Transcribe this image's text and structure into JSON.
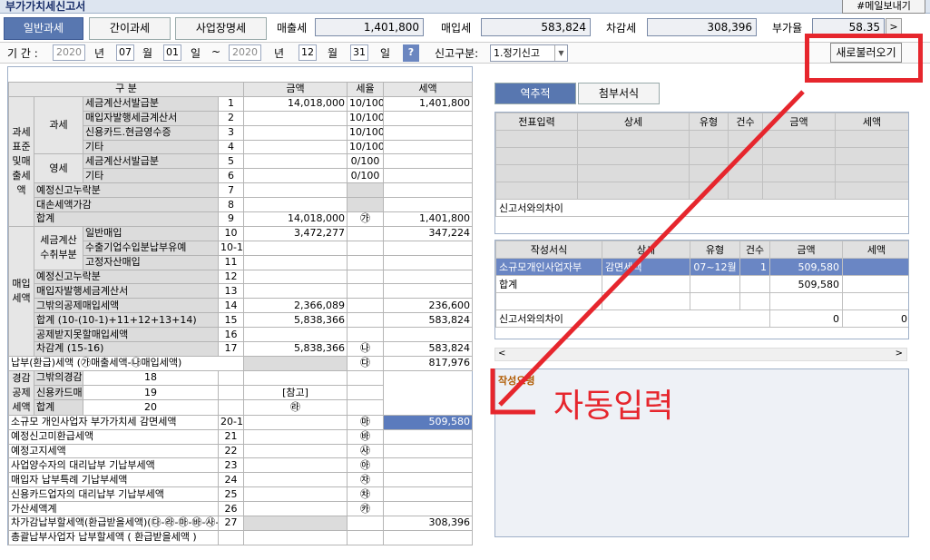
{
  "title": "부가가치세신고서",
  "mail_button": "#메일보내기",
  "tabs": [
    "일반과세",
    "간이과세",
    "사업장명세"
  ],
  "summary": {
    "sales_label": "매출세",
    "sales": "1,401,800",
    "purchase_label": "매입세",
    "purchase": "583,824",
    "diff_label": "차감세",
    "diff": "308,396",
    "rate_label": "부가율",
    "rate": "58.35",
    "next": ">"
  },
  "filter": {
    "period_label": "기 간 :",
    "y1": "2020",
    "year": "년",
    "m1": "07",
    "month": "월",
    "d1": "01",
    "day": "일",
    "tilde": "~",
    "y2": "2020",
    "m2": "12",
    "d2": "31",
    "help": "?",
    "type_label": "신고구분:",
    "type_value": "1.정기신고"
  },
  "reload_button": "새로불러오기",
  "main_headers": [
    "구 분",
    "금액",
    "세율",
    "세액"
  ],
  "side_labels": {
    "a": "과세표준및매출세액",
    "b": "과세",
    "c": "영세",
    "d": "매입세액",
    "e": "세금계산수취부분",
    "f": "경감공제세액"
  },
  "rows": [
    [
      "세금계산서발급분",
      "1",
      "14,018,000",
      "10/100",
      "1,401,800"
    ],
    [
      "매입자발행세금계산서",
      "2",
      "",
      "10/100",
      ""
    ],
    [
      "신용카드.현금영수증",
      "3",
      "",
      "10/100",
      ""
    ],
    [
      "기타",
      "4",
      "",
      "10/100",
      ""
    ],
    [
      "세금계산서발급분",
      "5",
      "",
      "0/100",
      ""
    ],
    [
      "기타",
      "6",
      "",
      "0/100",
      ""
    ],
    [
      "예정신고누락분",
      "7",
      "",
      "",
      ""
    ],
    [
      "대손세액가감",
      "8",
      "",
      "",
      ""
    ],
    [
      "합계",
      "9",
      "14,018,000",
      "㉮",
      "1,401,800"
    ],
    [
      "일반매입",
      "10",
      "3,472,277",
      "",
      "347,224"
    ],
    [
      "수출기업수입분납부유예",
      "10-1",
      "",
      "",
      ""
    ],
    [
      "고정자산매입",
      "11",
      "",
      "",
      ""
    ],
    [
      "예정신고누락분",
      "12",
      "",
      "",
      ""
    ],
    [
      "매입자발행세금계산서",
      "13",
      "",
      "",
      ""
    ],
    [
      "그밖의공제매입세액",
      "14",
      "2,366,089",
      "",
      "236,600"
    ],
    [
      "합계 (10-(10-1)+11+12+13+14)",
      "15",
      "5,838,366",
      "",
      "583,824"
    ],
    [
      "공제받지못할매입세액",
      "16",
      "",
      "",
      ""
    ],
    [
      "차감계 (15-16)",
      "17",
      "5,838,366",
      "㉯",
      "583,824"
    ],
    [
      "납부(환급)세액 (㉮매출세액-㉯매입세액)",
      "",
      "",
      "㉰",
      "817,976"
    ],
    [
      "그밖의경감·공제세액",
      "18",
      "",
      "",
      ""
    ],
    [
      "신용카드매출전표등발행공제계",
      "19",
      "",
      "[참고]",
      ""
    ],
    [
      "합계",
      "20",
      "",
      "㉱",
      ""
    ],
    [
      "소규모 개인사업자 부가가치세 감면세액",
      "20-1",
      "",
      "㉲",
      "509,580"
    ],
    [
      "예정신고미환급세액",
      "21",
      "",
      "㉳",
      ""
    ],
    [
      "예정고지세액",
      "22",
      "",
      "㉴",
      ""
    ],
    [
      "사업양수자의 대리납부 기납부세액",
      "23",
      "",
      "㉵",
      ""
    ],
    [
      "매입자 납부특례 기납부세액",
      "24",
      "",
      "㉶",
      ""
    ],
    [
      "신용카드업자의 대리납부 기납부세액",
      "25",
      "",
      "㉷",
      ""
    ],
    [
      "가산세액계",
      "26",
      "",
      "㉸",
      ""
    ],
    [
      "차가감납부할세액(환급받을세액)(㉰-㉱-㉲-㉳-㉴-㉵-㉶-㉷+㉸)",
      "27",
      "",
      "",
      "308,396"
    ],
    [
      "총괄납부사업자 납부할세액 ( 환급받을세액 )",
      "",
      "",
      "",
      ""
    ]
  ],
  "right_tabs": [
    "역추적",
    "첨부서식"
  ],
  "trace_headers": [
    "전표입력",
    "상세",
    "유형",
    "건수",
    "금액",
    "세액"
  ],
  "trace_footer": "신고서와의차이",
  "form_headers": [
    "작성서식",
    "상세",
    "유형",
    "건수",
    "금액",
    "세액"
  ],
  "form_rows": [
    [
      "소규모개인사업자부",
      "감면세액",
      "07~12월",
      "1",
      "509,580",
      ""
    ],
    [
      "합계",
      "",
      "",
      "",
      "509,580",
      ""
    ]
  ],
  "form_footer": {
    "label": "신고서와의차이",
    "amount": "0",
    "tax": "0"
  },
  "write_title": "작성요령",
  "annotation": "자동입력",
  "colors": {
    "accent": "#5877b0",
    "highlight": "#5b7bbd",
    "annotation": "#e6262d"
  }
}
